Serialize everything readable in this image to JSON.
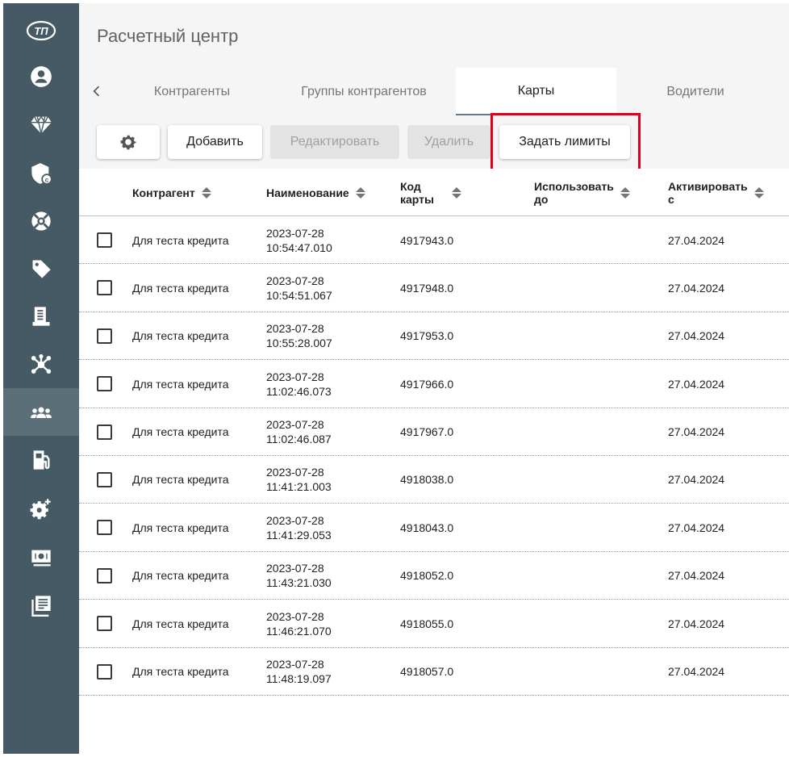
{
  "app": {
    "title": "Расчетный центр"
  },
  "sidebar": {
    "items": [
      {
        "icon": "logo-icon",
        "active": false
      },
      {
        "icon": "user-icon",
        "active": false
      },
      {
        "icon": "diamond-icon",
        "active": false
      },
      {
        "icon": "shield-icon",
        "active": false
      },
      {
        "icon": "lifebuoy-icon",
        "active": false
      },
      {
        "icon": "tag-icon",
        "active": false
      },
      {
        "icon": "receipt-icon",
        "active": false
      },
      {
        "icon": "network-icon",
        "active": false
      },
      {
        "icon": "users-icon",
        "active": true
      },
      {
        "icon": "fuel-icon",
        "active": false
      },
      {
        "icon": "settings-icon",
        "active": false
      },
      {
        "icon": "card-icon",
        "active": false
      },
      {
        "icon": "journal-icon",
        "active": false
      }
    ]
  },
  "tabs": [
    {
      "label": "Контрагенты",
      "active": false
    },
    {
      "label": "Группы контрагентов",
      "active": false
    },
    {
      "label": "Карты",
      "active": true
    },
    {
      "label": "Водители",
      "active": false
    }
  ],
  "toolbar": {
    "settings_icon": "gear-icon",
    "add": "Добавить",
    "edit": "Редактировать",
    "delete": "Удалить",
    "set_limits": "Задать лимиты"
  },
  "table": {
    "columns": [
      {
        "label": "Контрагент"
      },
      {
        "label": "Наименование"
      },
      {
        "label": "Код\nкарты"
      },
      {
        "label": "Использовать\nдо"
      },
      {
        "label": "Активировать\nс"
      }
    ],
    "rows": [
      {
        "counterparty": "Для теста кредита",
        "name_date": "2023-07-28",
        "name_time": "10:54:47.010",
        "code": "4917943.0",
        "use_until": "",
        "activate_from": "27.04.2024"
      },
      {
        "counterparty": "Для теста кредита",
        "name_date": "2023-07-28",
        "name_time": "10:54:51.067",
        "code": "4917948.0",
        "use_until": "",
        "activate_from": "27.04.2024"
      },
      {
        "counterparty": "Для теста кредита",
        "name_date": "2023-07-28",
        "name_time": "10:55:28.007",
        "code": "4917953.0",
        "use_until": "",
        "activate_from": "27.04.2024"
      },
      {
        "counterparty": "Для теста кредита",
        "name_date": "2023-07-28",
        "name_time": "11:02:46.073",
        "code": "4917966.0",
        "use_until": "",
        "activate_from": "27.04.2024"
      },
      {
        "counterparty": "Для теста кредита",
        "name_date": "2023-07-28",
        "name_time": "11:02:46.087",
        "code": "4917967.0",
        "use_until": "",
        "activate_from": "27.04.2024"
      },
      {
        "counterparty": "Для теста кредита",
        "name_date": "2023-07-28",
        "name_time": "11:41:21.003",
        "code": "4918038.0",
        "use_until": "",
        "activate_from": "27.04.2024"
      },
      {
        "counterparty": "Для теста кредита",
        "name_date": "2023-07-28",
        "name_time": "11:41:29.053",
        "code": "4918043.0",
        "use_until": "",
        "activate_from": "27.04.2024"
      },
      {
        "counterparty": "Для теста кредита",
        "name_date": "2023-07-28",
        "name_time": "11:43:21.030",
        "code": "4918052.0",
        "use_until": "",
        "activate_from": "27.04.2024"
      },
      {
        "counterparty": "Для теста кредита",
        "name_date": "2023-07-28",
        "name_time": "11:46:21.070",
        "code": "4918055.0",
        "use_until": "",
        "activate_from": "27.04.2024"
      },
      {
        "counterparty": "Для теста кредита",
        "name_date": "2023-07-28",
        "name_time": "11:48:19.097",
        "code": "4918057.0",
        "use_until": "",
        "activate_from": "27.04.2024"
      }
    ]
  },
  "colors": {
    "sidebar": "#455a64",
    "sidebar_active": "#5b6f79",
    "highlight": "#e0001b",
    "toolbar_bg": "#f5f5f5"
  }
}
